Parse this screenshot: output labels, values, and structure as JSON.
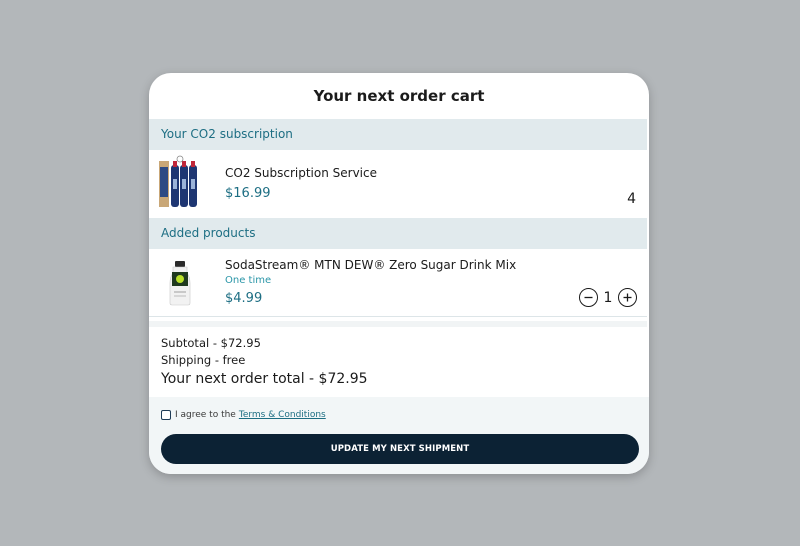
{
  "modal": {
    "title": "Your next order cart"
  },
  "subscription_section": {
    "header": "Your CO2 subscription",
    "item": {
      "name": "CO2 Subscription Service",
      "price": "$16.99",
      "quantity": "4"
    }
  },
  "added_section": {
    "header": "Added products",
    "item": {
      "name": "SodaStream® MTN DEW® Zero Sugar Drink Mix",
      "frequency": "One time",
      "price": "$4.99",
      "quantity": "1"
    }
  },
  "summary": {
    "subtotal": "Subtotal - $72.95",
    "shipping": "Shipping - free",
    "total": "Your next order total - $72.95"
  },
  "footer": {
    "agree_text": "I agree to the",
    "terms_link": "Terms & Conditions",
    "checked": false,
    "cta_label": "UPDATE MY NEXT SHIPMENT"
  },
  "icons": {
    "stepper_minus": "minus-circle-icon",
    "stepper_plus": "plus-circle-icon"
  },
  "colors": {
    "accent": "#1d6e83",
    "section_bg": "#e1eaed",
    "cta_bg": "#0c2234",
    "backdrop": "#b3b7ba"
  }
}
